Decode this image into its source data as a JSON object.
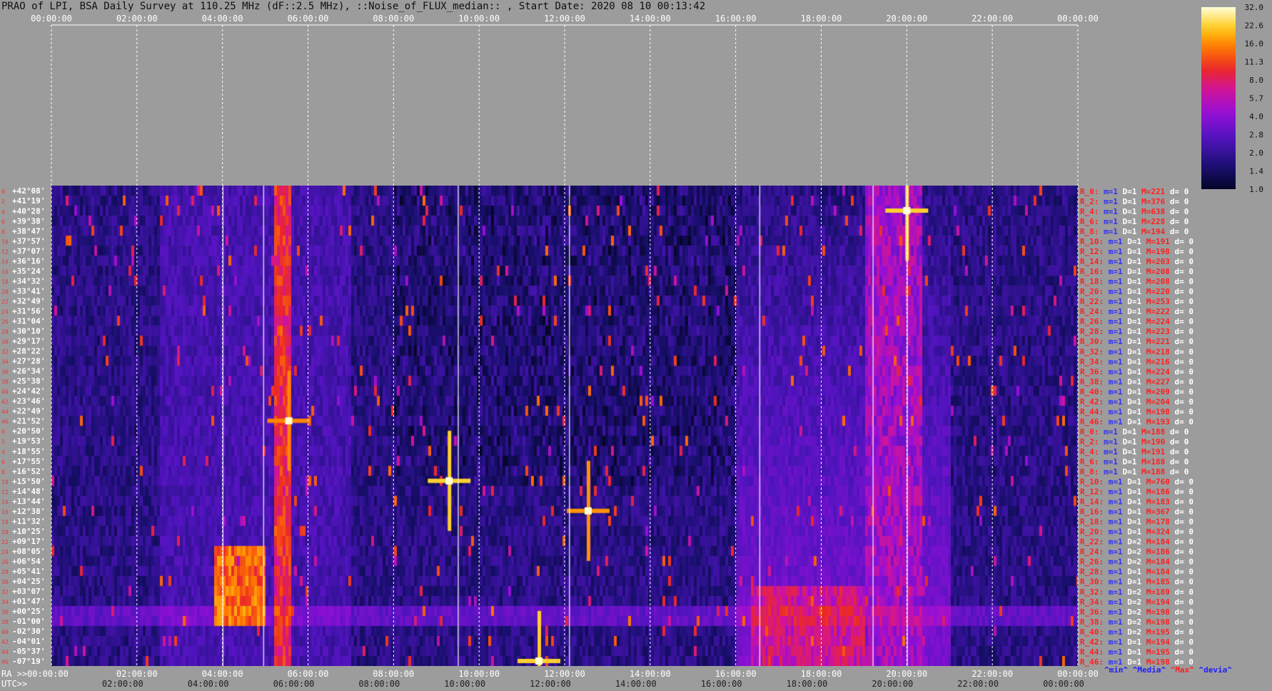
{
  "title": "PRAO of LPI, BSA Daily Survey at 110.25 MHz (dF::2.5 MHz), ::Noise_of_FLUX_median:: , Start Date: 2020 08 10 00:13:42",
  "colors": {
    "background": "#9c9c9c",
    "heat_low": "#05052a",
    "heat_mid": "#9a10d8",
    "heat_high": "#ffff60",
    "stat_label": "#ff2020",
    "stat_min": "#3030ff"
  },
  "top_time_labels": [
    "00:00:00",
    "02:00:00",
    "04:00:00",
    "06:00:00",
    "08:00:00",
    "10:00:00",
    "12:00:00",
    "14:00:00",
    "16:00:00",
    "18:00:00",
    "20:00:00",
    "22:00:00",
    "00:00:00"
  ],
  "ra_prefix": "RA >>",
  "ra_labels": [
    "00:00:00",
    "02:00:00",
    "04:00:00",
    "06:00:00",
    "08:00:00",
    "10:00:00",
    "12:00:00",
    "14:00:00",
    "16:00:00",
    "18:00:00",
    "20:00:00",
    "22:00:00",
    "00:00:00"
  ],
  "utc_prefix": "UTC>>",
  "utc_labels": [
    "02:00:00",
    "04:00:00",
    "06:00:00",
    "08:00:00",
    "10:00:00",
    "12:00:00",
    "14:00:00",
    "16:00:00",
    "18:00:00",
    "20:00:00",
    "22:00:00",
    "00:00:00"
  ],
  "colorbar_ticks": [
    "32.0",
    "22.6",
    "16.0",
    "11.3",
    "8.0",
    "5.7",
    "4.0",
    "2.8",
    "2.0",
    "1.4",
    "1.0"
  ],
  "legend": {
    "min": "^min^",
    "media": "^Media^",
    "max": "^Max^",
    "devia": "^devia^"
  },
  "chart_data": {
    "type": "heatmap",
    "title": "PRAO of LPI, BSA Daily Survey at 110.25 MHz (dF::2.5 MHz), ::Noise_of_FLUX_median:: , Start Date: 2020 08 10 00:13:42",
    "xlabel": "RA / UTC",
    "x_range": [
      "00:00:00",
      "24:00:00"
    ],
    "color_range": [
      1.0,
      32.0
    ],
    "declinations": [
      "+42°08'",
      "+41°19'",
      "+40°28'",
      "+39°38'",
      "+38°47'",
      "+37°57'",
      "+37°07'",
      "+36°16'",
      "+35°24'",
      "+34°32'",
      "+33°41'",
      "+32°49'",
      "+31°56'",
      "+31°04'",
      "+30°10'",
      "+29°17'",
      "+28°22'",
      "+27°28'",
      "+26°34'",
      "+25°38'",
      "+24°42'",
      "+23°46'",
      "+22°49'",
      "+21°52'",
      "+20°50'",
      "+19°53'",
      "+18°55'",
      "+17°55'",
      "+16°52'",
      "+15°50'",
      "+14°48'",
      "+13°44'",
      "+12°38'",
      "+11°32'",
      "+10°25'",
      "+09°17'",
      "+08°05'",
      "+06°54'",
      "+05°41'",
      "+04°25'",
      "+03°07'",
      "+01°47'",
      "+00°25'",
      "-01°00'",
      "-02°30'",
      "-04°01'",
      "-05°37'",
      "-07°19'"
    ],
    "row_indices": [
      "0",
      "2",
      "4",
      "6",
      "8",
      "10",
      "12",
      "14",
      "16",
      "18",
      "20",
      "22",
      "24",
      "26",
      "28",
      "30",
      "32",
      "34",
      "36",
      "38",
      "40",
      "42",
      "44",
      "46",
      "0",
      "2",
      "4",
      "6",
      "8",
      "10",
      "12",
      "14",
      "16",
      "18",
      "20",
      "22",
      "24",
      "26",
      "28",
      "30",
      "32",
      "34",
      "36",
      "38",
      "40",
      "42",
      "44",
      "46"
    ],
    "row_stats": [
      {
        "label": "R_0:",
        "min": "m=1",
        "D": "D=1",
        "max": "M=221",
        "dev": "d= 0"
      },
      {
        "label": "R_2:",
        "min": "m=1",
        "D": "D=1",
        "max": "M=376",
        "dev": "d= 0"
      },
      {
        "label": "R_4:",
        "min": "m=1",
        "D": "D=1",
        "max": "M=638",
        "dev": "d= 0"
      },
      {
        "label": "R_6:",
        "min": "m=1",
        "D": "D=1",
        "max": "M=228",
        "dev": "d= 0"
      },
      {
        "label": "R_8:",
        "min": "m=1",
        "D": "D=1",
        "max": "M=194",
        "dev": "d= 0"
      },
      {
        "label": "R_10:",
        "min": "m=1",
        "D": "D=1",
        "max": "M=191",
        "dev": "d= 0"
      },
      {
        "label": "R_12:",
        "min": "m=1",
        "D": "D=1",
        "max": "M=198",
        "dev": "d= 0"
      },
      {
        "label": "R_14:",
        "min": "m=1",
        "D": "D=1",
        "max": "M=203",
        "dev": "d= 0"
      },
      {
        "label": "R_16:",
        "min": "m=1",
        "D": "D=1",
        "max": "M=208",
        "dev": "d= 0"
      },
      {
        "label": "R_18:",
        "min": "m=1",
        "D": "D=1",
        "max": "M=208",
        "dev": "d= 0"
      },
      {
        "label": "R_20:",
        "min": "m=1",
        "D": "D=1",
        "max": "M=220",
        "dev": "d= 0"
      },
      {
        "label": "R_22:",
        "min": "m=1",
        "D": "D=1",
        "max": "M=253",
        "dev": "d= 0"
      },
      {
        "label": "R_24:",
        "min": "m=1",
        "D": "D=1",
        "max": "M=222",
        "dev": "d= 0"
      },
      {
        "label": "R_26:",
        "min": "m=1",
        "D": "D=1",
        "max": "M=224",
        "dev": "d= 0"
      },
      {
        "label": "R_28:",
        "min": "m=1",
        "D": "D=1",
        "max": "M=223",
        "dev": "d= 0"
      },
      {
        "label": "R_30:",
        "min": "m=1",
        "D": "D=1",
        "max": "M=221",
        "dev": "d= 0"
      },
      {
        "label": "R_32:",
        "min": "m=1",
        "D": "D=1",
        "max": "M=218",
        "dev": "d= 0"
      },
      {
        "label": "R_34:",
        "min": "m=1",
        "D": "D=1",
        "max": "M=216",
        "dev": "d= 0"
      },
      {
        "label": "R_36:",
        "min": "m=1",
        "D": "D=1",
        "max": "M=224",
        "dev": "d= 0"
      },
      {
        "label": "R_38:",
        "min": "m=1",
        "D": "D=1",
        "max": "M=227",
        "dev": "d= 0"
      },
      {
        "label": "R_40:",
        "min": "m=1",
        "D": "D=1",
        "max": "M=209",
        "dev": "d= 0"
      },
      {
        "label": "R_42:",
        "min": "m=1",
        "D": "D=1",
        "max": "M=204",
        "dev": "d= 0"
      },
      {
        "label": "R_44:",
        "min": "m=1",
        "D": "D=1",
        "max": "M=198",
        "dev": "d= 0"
      },
      {
        "label": "R_46:",
        "min": "m=1",
        "D": "D=1",
        "max": "M=193",
        "dev": "d= 0"
      },
      {
        "label": "R_0:",
        "min": "m=1",
        "D": "D=1",
        "max": "M=188",
        "dev": "d= 0"
      },
      {
        "label": "R_2:",
        "min": "m=1",
        "D": "D=1",
        "max": "M=190",
        "dev": "d= 0"
      },
      {
        "label": "R_4:",
        "min": "m=1",
        "D": "D=1",
        "max": "M=191",
        "dev": "d= 0"
      },
      {
        "label": "R_6:",
        "min": "m=1",
        "D": "D=1",
        "max": "M=188",
        "dev": "d= 0"
      },
      {
        "label": "R_8:",
        "min": "m=1",
        "D": "D=1",
        "max": "M=188",
        "dev": "d= 0"
      },
      {
        "label": "R_10:",
        "min": "m=1",
        "D": "D=1",
        "max": "M=760",
        "dev": "d= 0"
      },
      {
        "label": "R_12:",
        "min": "m=1",
        "D": "D=1",
        "max": "M=186",
        "dev": "d= 0"
      },
      {
        "label": "R_14:",
        "min": "m=1",
        "D": "D=1",
        "max": "M=183",
        "dev": "d= 0"
      },
      {
        "label": "R_16:",
        "min": "m=1",
        "D": "D=1",
        "max": "M=367",
        "dev": "d= 0"
      },
      {
        "label": "R_18:",
        "min": "m=1",
        "D": "D=1",
        "max": "M=178",
        "dev": "d= 0"
      },
      {
        "label": "R_20:",
        "min": "m=1",
        "D": "D=1",
        "max": "M=324",
        "dev": "d= 0"
      },
      {
        "label": "R_22:",
        "min": "m=1",
        "D": "D=2",
        "max": "M=184",
        "dev": "d= 0"
      },
      {
        "label": "R_24:",
        "min": "m=1",
        "D": "D=2",
        "max": "M=186",
        "dev": "d= 0"
      },
      {
        "label": "R_26:",
        "min": "m=1",
        "D": "D=2",
        "max": "M=184",
        "dev": "d= 0"
      },
      {
        "label": "R_28:",
        "min": "m=1",
        "D": "D=1",
        "max": "M=184",
        "dev": "d= 0"
      },
      {
        "label": "R_30:",
        "min": "m=1",
        "D": "D=1",
        "max": "M=185",
        "dev": "d= 0"
      },
      {
        "label": "R_32:",
        "min": "m=1",
        "D": "D=2",
        "max": "M=189",
        "dev": "d= 0"
      },
      {
        "label": "R_34:",
        "min": "m=1",
        "D": "D=2",
        "max": "M=194",
        "dev": "d= 0"
      },
      {
        "label": "R_36:",
        "min": "m=1",
        "D": "D=2",
        "max": "M=198",
        "dev": "d= 0"
      },
      {
        "label": "R_38:",
        "min": "m=1",
        "D": "D=2",
        "max": "M=198",
        "dev": "d= 0"
      },
      {
        "label": "R_40:",
        "min": "m=1",
        "D": "D=2",
        "max": "M=195",
        "dev": "d= 0"
      },
      {
        "label": "R_42:",
        "min": "m=1",
        "D": "D=1",
        "max": "M=194",
        "dev": "d= 0"
      },
      {
        "label": "R_44:",
        "min": "m=1",
        "D": "D=1",
        "max": "M=195",
        "dev": "d= 0"
      },
      {
        "label": "R_46:",
        "min": "m=1",
        "D": "D=1",
        "max": "M=198",
        "dev": "d= 0"
      }
    ],
    "bright_sources": [
      {
        "ra_h": 20.0,
        "dec": "+40°28'",
        "value": 32.0
      },
      {
        "ra_h": 9.3,
        "dec": "+15°50'",
        "value": 32.0
      },
      {
        "ra_h": 12.55,
        "dec": "+12°38'",
        "value": 24.0
      },
      {
        "ra_h": 11.4,
        "dec": "-07°19'",
        "value": 32.0
      },
      {
        "ra_h": 5.55,
        "dec": "+21°52'",
        "value": 22.6
      }
    ],
    "bands": [
      {
        "ra_start_h": 3.75,
        "ra_end_h": 5.0,
        "dec_from": "+08°05'",
        "dec_to": "-01°00'",
        "value": 16.0
      },
      {
        "ra_start_h": 5.2,
        "ra_end_h": 5.6,
        "dec_from": "+42°08'",
        "dec_to": "-07°19'",
        "value": 11.3
      },
      {
        "ra_start_h": 16.3,
        "ra_end_h": 19.0,
        "dec_from": "+03°07'",
        "dec_to": "-07°19'",
        "value": 8.0
      },
      {
        "ra_start_h": 19.0,
        "ra_end_h": 20.3,
        "dec_from": "+42°08'",
        "dec_to": "-07°19'",
        "value": 5.7
      }
    ],
    "grid": true,
    "legend_position": "right"
  }
}
